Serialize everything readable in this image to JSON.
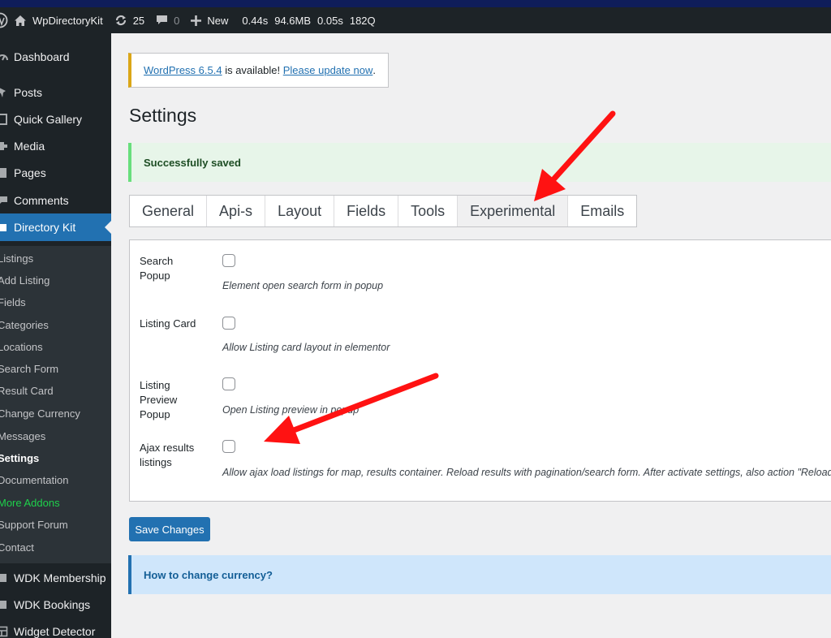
{
  "adminbar": {
    "site_name": "WpDirectoryKit",
    "updates_count": "25",
    "comments_count": "0",
    "new_label": "New",
    "perf": [
      "0.44s",
      "94.6MB",
      "0.05s",
      "182Q"
    ]
  },
  "sidebar": {
    "menu": [
      {
        "label": "Dashboard",
        "icon": "dashboard-icon"
      },
      {
        "label": "Posts",
        "icon": "pin-icon"
      },
      {
        "label": "Quick Gallery",
        "icon": "gallery-icon"
      },
      {
        "label": "Media",
        "icon": "media-icon"
      },
      {
        "label": "Pages",
        "icon": "page-icon"
      },
      {
        "label": "Comments",
        "icon": "comment-icon"
      },
      {
        "label": "Directory Kit",
        "icon": "directory-icon"
      }
    ],
    "submenu": [
      "Listings",
      "Add Listing",
      "Fields",
      "Categories",
      "Locations",
      "Search Form",
      "Result Card",
      "Change Currency",
      "Messages",
      "Settings",
      "Documentation",
      "More Addons",
      "Support Forum",
      "Contact"
    ],
    "after_menu": [
      {
        "label": "WDK Membership",
        "icon": "membership-icon"
      },
      {
        "label": "WDK Bookings",
        "icon": "bookings-icon"
      },
      {
        "label": "Widget Detector",
        "icon": "widget-icon"
      }
    ]
  },
  "notice_update": {
    "link1": "WordPress 6.5.4",
    "middle": " is available! ",
    "link2": "Please update now",
    "end": "."
  },
  "page_title": "Settings",
  "notice_success": "Successfully saved",
  "tabs": [
    "General",
    "Api-s",
    "Layout",
    "Fields",
    "Tools",
    "Experimental",
    "Emails"
  ],
  "active_tab": "Experimental",
  "settings": [
    {
      "label_lines": [
        "Search",
        "Popup"
      ],
      "description": "Element open search form in popup",
      "checked": false
    },
    {
      "label_lines": [
        "Listing Card"
      ],
      "description": "Allow Listing card layout in elementor",
      "checked": false
    },
    {
      "label_lines": [
        "Listing",
        "Preview",
        "Popup"
      ],
      "description": "Open Listing preview in popup",
      "checked": false
    },
    {
      "label_lines": [
        "Ajax results",
        "listings"
      ],
      "description": "Allow ajax load listings for map, results container. Reload results with pagination/search form. After activate settings, also action \"Reload co",
      "checked": false
    }
  ],
  "save_button": "Save Changes",
  "notice_info": "How to change currency?",
  "colors": {
    "admin_dark": "#1d2327",
    "accent_blue": "#2271b1",
    "annotation_red": "#ff1212",
    "success_bg": "#e7f5e9"
  }
}
